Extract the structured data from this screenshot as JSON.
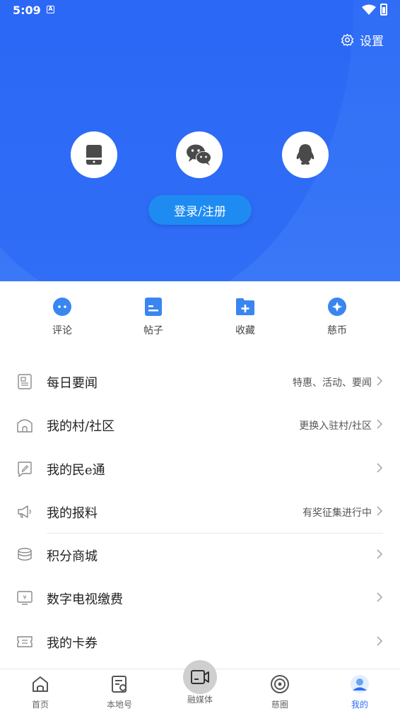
{
  "status_bar": {
    "time": "5:09",
    "notif_icon": "A"
  },
  "header": {
    "settings_label": "设置",
    "login_button_label": "登录/注册",
    "login_methods": [
      "phone-icon",
      "wechat-icon",
      "qq-icon"
    ]
  },
  "quick_actions": [
    {
      "label": "评论",
      "icon": "comment-icon"
    },
    {
      "label": "帖子",
      "icon": "post-icon"
    },
    {
      "label": "收藏",
      "icon": "favorites-icon"
    },
    {
      "label": "慈币",
      "icon": "coin-icon"
    }
  ],
  "menu": [
    {
      "label": "每日要闻",
      "hint": "特惠、活动、要闻",
      "icon": "newspaper-icon"
    },
    {
      "label": "我的村/社区",
      "hint": "更换入驻村/社区",
      "icon": "home-icon"
    },
    {
      "label": "我的民e通",
      "hint": "",
      "icon": "edit-icon"
    },
    {
      "label": "我的报料",
      "hint": "有奖征集进行中",
      "icon": "megaphone-icon"
    },
    {
      "label": "积分商城",
      "hint": "",
      "icon": "coins-stack-icon"
    },
    {
      "label": "数字电视缴费",
      "hint": "",
      "icon": "tv-payment-icon"
    },
    {
      "label": "我的卡券",
      "hint": "",
      "icon": "ticket-icon"
    }
  ],
  "bottom_nav": [
    {
      "label": "首页",
      "icon": "home-nav-icon"
    },
    {
      "label": "本地号",
      "icon": "local-icon"
    },
    {
      "label": "融媒体",
      "icon": "video-icon"
    },
    {
      "label": "慈圈",
      "icon": "target-icon"
    },
    {
      "label": "我的",
      "icon": "profile-icon",
      "active": true
    }
  ],
  "colors": {
    "primary": "#2f6df6",
    "login_button": "#1e8bf3",
    "quick_icon": "#3a86f0"
  }
}
